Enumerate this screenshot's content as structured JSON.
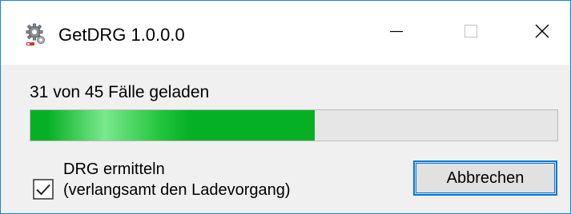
{
  "window": {
    "title": "GetDRG 1.0.0.0",
    "app_icon": "gear-icon",
    "controls": {
      "minimize_icon": "minimize-icon",
      "maximize_icon": "maximize-icon",
      "close_icon": "close-icon"
    }
  },
  "status": {
    "text": "31 von 45 Fälle geladen",
    "loaded": 31,
    "total": 45
  },
  "progress": {
    "fraction": 0.54,
    "fill_color": "#06b025",
    "track_color": "#e6e6e6"
  },
  "option": {
    "checked": true,
    "label_line1": "DRG ermitteln",
    "label_line2": "(verlangsamt den Ladevorgang)"
  },
  "buttons": {
    "cancel_label": "Abbrechen",
    "accent_color": "#0078d7"
  }
}
